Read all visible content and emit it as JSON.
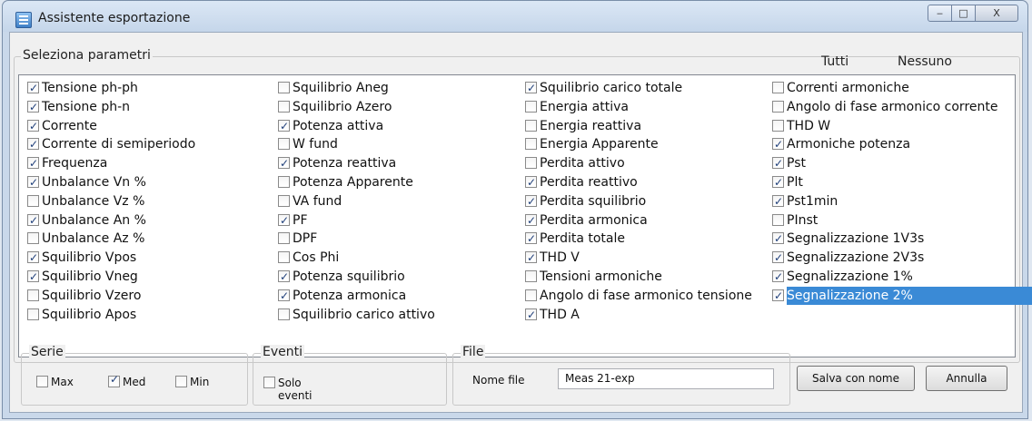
{
  "window": {
    "title": "Assistente esportazione",
    "controls": {
      "minimize": "‒",
      "maximize": "□",
      "close": "X"
    }
  },
  "parametri": {
    "title": "Seleziona parametri",
    "tutti": "Tutti",
    "nessuno": "Nessuno",
    "columns": [
      [
        {
          "label": "Tensione ph-ph",
          "checked": true
        },
        {
          "label": "Tensione ph-n",
          "checked": true
        },
        {
          "label": "Corrente",
          "checked": true
        },
        {
          "label": "Corrente di semiperiodo",
          "checked": true
        },
        {
          "label": "Frequenza",
          "checked": true
        },
        {
          "label": "Unbalance Vn %",
          "checked": true
        },
        {
          "label": "Unbalance Vz %",
          "checked": false
        },
        {
          "label": "Unbalance An %",
          "checked": true
        },
        {
          "label": "Unbalance Az %",
          "checked": false
        },
        {
          "label": "Squilibrio Vpos",
          "checked": true
        },
        {
          "label": "Squilibrio Vneg",
          "checked": true
        },
        {
          "label": "Squilibrio Vzero",
          "checked": false
        },
        {
          "label": "Squilibrio Apos",
          "checked": false
        }
      ],
      [
        {
          "label": "Squilibrio Aneg",
          "checked": false
        },
        {
          "label": "Squilibrio Azero",
          "checked": false
        },
        {
          "label": "Potenza attiva",
          "checked": true
        },
        {
          "label": "W fund",
          "checked": false
        },
        {
          "label": "Potenza reattiva",
          "checked": true
        },
        {
          "label": "Potenza Apparente",
          "checked": false
        },
        {
          "label": "VA fund",
          "checked": false
        },
        {
          "label": "PF",
          "checked": true
        },
        {
          "label": "DPF",
          "checked": false
        },
        {
          "label": "Cos Phi",
          "checked": false
        },
        {
          "label": "Potenza squilibrio",
          "checked": true
        },
        {
          "label": "Potenza armonica",
          "checked": true
        },
        {
          "label": "Squilibrio carico attivo",
          "checked": false
        }
      ],
      [
        {
          "label": "Squilibrio carico totale",
          "checked": true
        },
        {
          "label": "Energia attiva",
          "checked": false
        },
        {
          "label": "Energia reattiva",
          "checked": false
        },
        {
          "label": "Energia Apparente",
          "checked": false
        },
        {
          "label": "Perdita attivo",
          "checked": false
        },
        {
          "label": "Perdita reattivo",
          "checked": true
        },
        {
          "label": "Perdita squilibrio",
          "checked": true
        },
        {
          "label": "Perdita armonica",
          "checked": true
        },
        {
          "label": "Perdita totale",
          "checked": true
        },
        {
          "label": "THD V",
          "checked": true
        },
        {
          "label": "Tensioni armoniche",
          "checked": false
        },
        {
          "label": "Angolo di fase armonico tensione",
          "checked": false
        },
        {
          "label": "THD A",
          "checked": true
        }
      ],
      [
        {
          "label": "Correnti armoniche",
          "checked": false
        },
        {
          "label": "Angolo di fase armonico corrente",
          "checked": false
        },
        {
          "label": "THD W",
          "checked": false
        },
        {
          "label": "Armoniche potenza",
          "checked": true
        },
        {
          "label": "Pst",
          "checked": true
        },
        {
          "label": "Plt",
          "checked": true
        },
        {
          "label": "Pst1min",
          "checked": true
        },
        {
          "label": "PInst",
          "checked": false
        },
        {
          "label": "Segnalizzazione 1V3s",
          "checked": true
        },
        {
          "label": "Segnalizzazione 2V3s",
          "checked": true
        },
        {
          "label": "Segnalizzazione 1%",
          "checked": true
        },
        {
          "label": "Segnalizzazione 2%",
          "checked": true,
          "selected": true
        }
      ]
    ]
  },
  "serie": {
    "title": "Serie",
    "max": {
      "label": "Max",
      "checked": false
    },
    "med": {
      "label": "Med",
      "checked": true
    },
    "min": {
      "label": "Min",
      "checked": false
    }
  },
  "eventi": {
    "title": "Eventi",
    "solo_eventi": {
      "label": "Solo eventi",
      "checked": false
    }
  },
  "file": {
    "title": "File",
    "nome_file_label": "Nome file",
    "nome_file_value": "Meas 21-exp"
  },
  "buttons": {
    "salva": "Salva con nome",
    "annulla": "Annulla"
  },
  "colors": {
    "selection": "#3a8ad6",
    "check": "#1f3f7a"
  }
}
